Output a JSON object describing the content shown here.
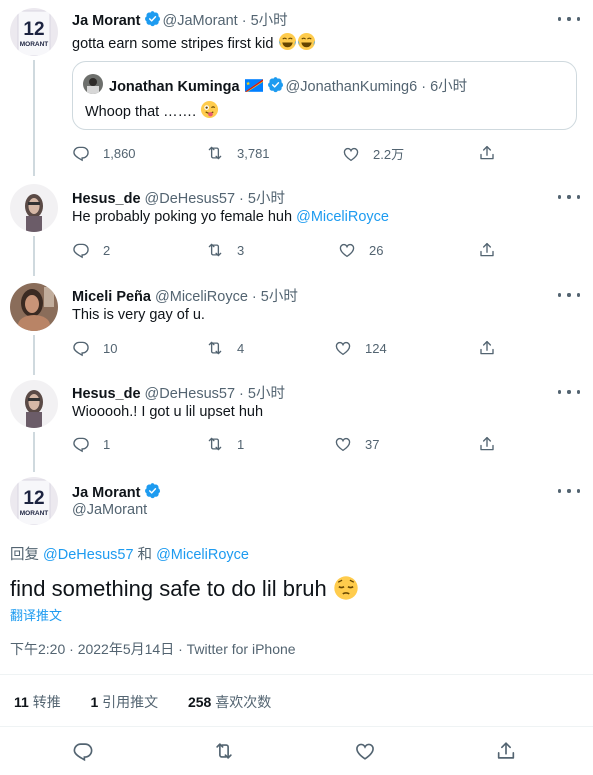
{
  "tweets": [
    {
      "name": "Ja Morant",
      "handle": "@JaMorant",
      "time": "5小时",
      "text": "gotta earn some stripes first kid",
      "emoji": "joy-emoji x2",
      "quote": {
        "name": "Jonathan Kuminga",
        "flag": "congo-flag",
        "handle": "@JonathanKuming6",
        "time": "6小时",
        "text": "Whoop that ……."
      },
      "reply_count": "1,860",
      "retweet_count": "3,781",
      "like_count": "2.2万"
    },
    {
      "name": "Hesus_de",
      "handle": "@DeHesus57",
      "time": "5小时",
      "text": "He probably poking yo female huh ",
      "mention": "@MiceliRoyce",
      "reply_count": "2",
      "retweet_count": "3",
      "like_count": "26"
    },
    {
      "name": "Miceli Peña",
      "handle": "@MiceliRoyce",
      "time": "5小时",
      "text": "This is very gay of u.",
      "reply_count": "10",
      "retweet_count": "4",
      "like_count": "124"
    },
    {
      "name": "Hesus_de",
      "handle": "@DeHesus57",
      "time": "5小时",
      "text": "Wiooooh.! I got u lil upset huh",
      "reply_count": "1",
      "retweet_count": "1",
      "like_count": "37"
    }
  ],
  "main": {
    "name": "Ja Morant",
    "handle": "@JaMorant",
    "reply_prefix": "回复 ",
    "reply_to_1": "@DeHesus57",
    "reply_joiner": " 和 ",
    "reply_to_2": "@MiceliRoyce",
    "text": "find something safe to do lil bruh",
    "emoji": "pensive-emoji",
    "translate": "翻译推文",
    "meta": "下午2:20 · 2022年5月14日 · Twitter for iPhone",
    "stats": {
      "retweets_num": "11",
      "retweets_label": "转推",
      "quotes_num": "1",
      "quotes_label": "引用推文",
      "likes_num": "258",
      "likes_label": "喜欢次数"
    }
  },
  "colors": {
    "accent": "#1d9bf0",
    "secondary_text": "#536471",
    "border": "#cfd9de"
  }
}
